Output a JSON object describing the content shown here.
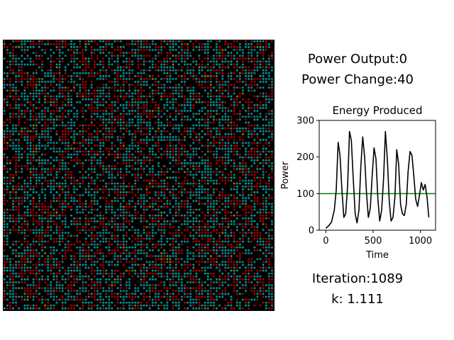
{
  "status": {
    "power_output": "Power Output:0",
    "power_change": "Power Change:40",
    "iteration": "Iteration:1089",
    "k": "k: 1.111"
  },
  "grid_colors": {
    "background": "#000000",
    "red": "#e00000",
    "cyan": "#00c8c8",
    "orange": "#d9a000"
  },
  "chart_data": {
    "type": "line",
    "title": "Energy Produced",
    "xlabel": "Time",
    "ylabel": "Power",
    "xlim": [
      -70,
      1160
    ],
    "ylim": [
      0,
      300
    ],
    "xticks": [
      "0",
      "500",
      "1000"
    ],
    "yticks": [
      "0",
      "100",
      "200",
      "300"
    ],
    "reference_line": {
      "y": 100,
      "color": "#008000"
    },
    "series": [
      {
        "color": "#000000",
        "x": [
          0,
          30,
          60,
          90,
          110,
          130,
          150,
          170,
          190,
          210,
          230,
          250,
          270,
          290,
          310,
          330,
          350,
          370,
          390,
          410,
          430,
          450,
          470,
          490,
          510,
          530,
          550,
          570,
          590,
          610,
          630,
          650,
          670,
          690,
          710,
          730,
          750,
          770,
          790,
          810,
          830,
          850,
          870,
          890,
          910,
          930,
          950,
          970,
          990,
          1010,
          1030,
          1050,
          1070,
          1089
        ],
        "y": [
          5,
          12,
          22,
          55,
          110,
          240,
          205,
          110,
          35,
          45,
          120,
          270,
          245,
          140,
          45,
          20,
          55,
          175,
          255,
          200,
          100,
          35,
          60,
          150,
          225,
          195,
          85,
          25,
          55,
          140,
          270,
          195,
          80,
          25,
          35,
          90,
          220,
          180,
          70,
          45,
          40,
          70,
          160,
          215,
          205,
          150,
          85,
          65,
          95,
          130,
          110,
          125,
          90,
          35
        ]
      }
    ]
  }
}
